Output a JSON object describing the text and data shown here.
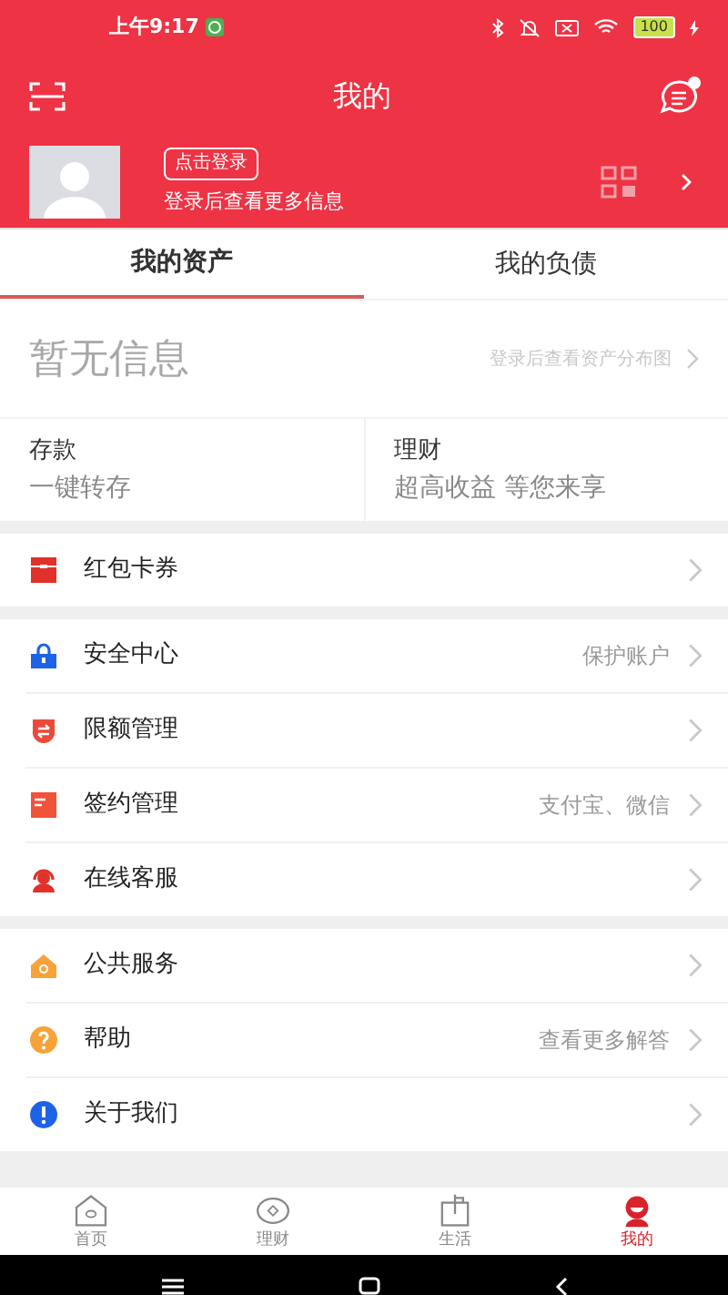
{
  "status_bar": {
    "time": "上午9:17",
    "battery": "100"
  },
  "header": {
    "title": "我的",
    "notification_dot": true
  },
  "profile": {
    "login_button": "点击登录",
    "subtitle": "登录后查看更多信息"
  },
  "tabs": [
    {
      "label": "我的资产",
      "selected": true
    },
    {
      "label": "我的负债",
      "selected": false
    }
  ],
  "assets": {
    "empty_text": "暂无信息",
    "link": "登录后查看资产分布图"
  },
  "shortcuts": [
    {
      "title": "存款",
      "subtitle": "一键转存"
    },
    {
      "title": "理财",
      "subtitle": "超高收益 等您来享"
    }
  ],
  "menu_groups": [
    [
      {
        "label": "红包卡券"
      }
    ],
    [
      {
        "label": "安全中心",
        "hint": "保护账户"
      },
      {
        "label": "限额管理"
      },
      {
        "label": "签约管理",
        "hint": "支付宝、微信"
      },
      {
        "label": "在线客服"
      }
    ],
    [
      {
        "label": "公共服务"
      },
      {
        "label": "帮助",
        "hint": "查看更多解答"
      },
      {
        "label": "关于我们"
      }
    ]
  ],
  "bottom_nav": [
    {
      "label": "首页",
      "selected": false
    },
    {
      "label": "理财",
      "selected": false
    },
    {
      "label": "生活",
      "selected": false
    },
    {
      "label": "我的",
      "selected": true
    }
  ]
}
